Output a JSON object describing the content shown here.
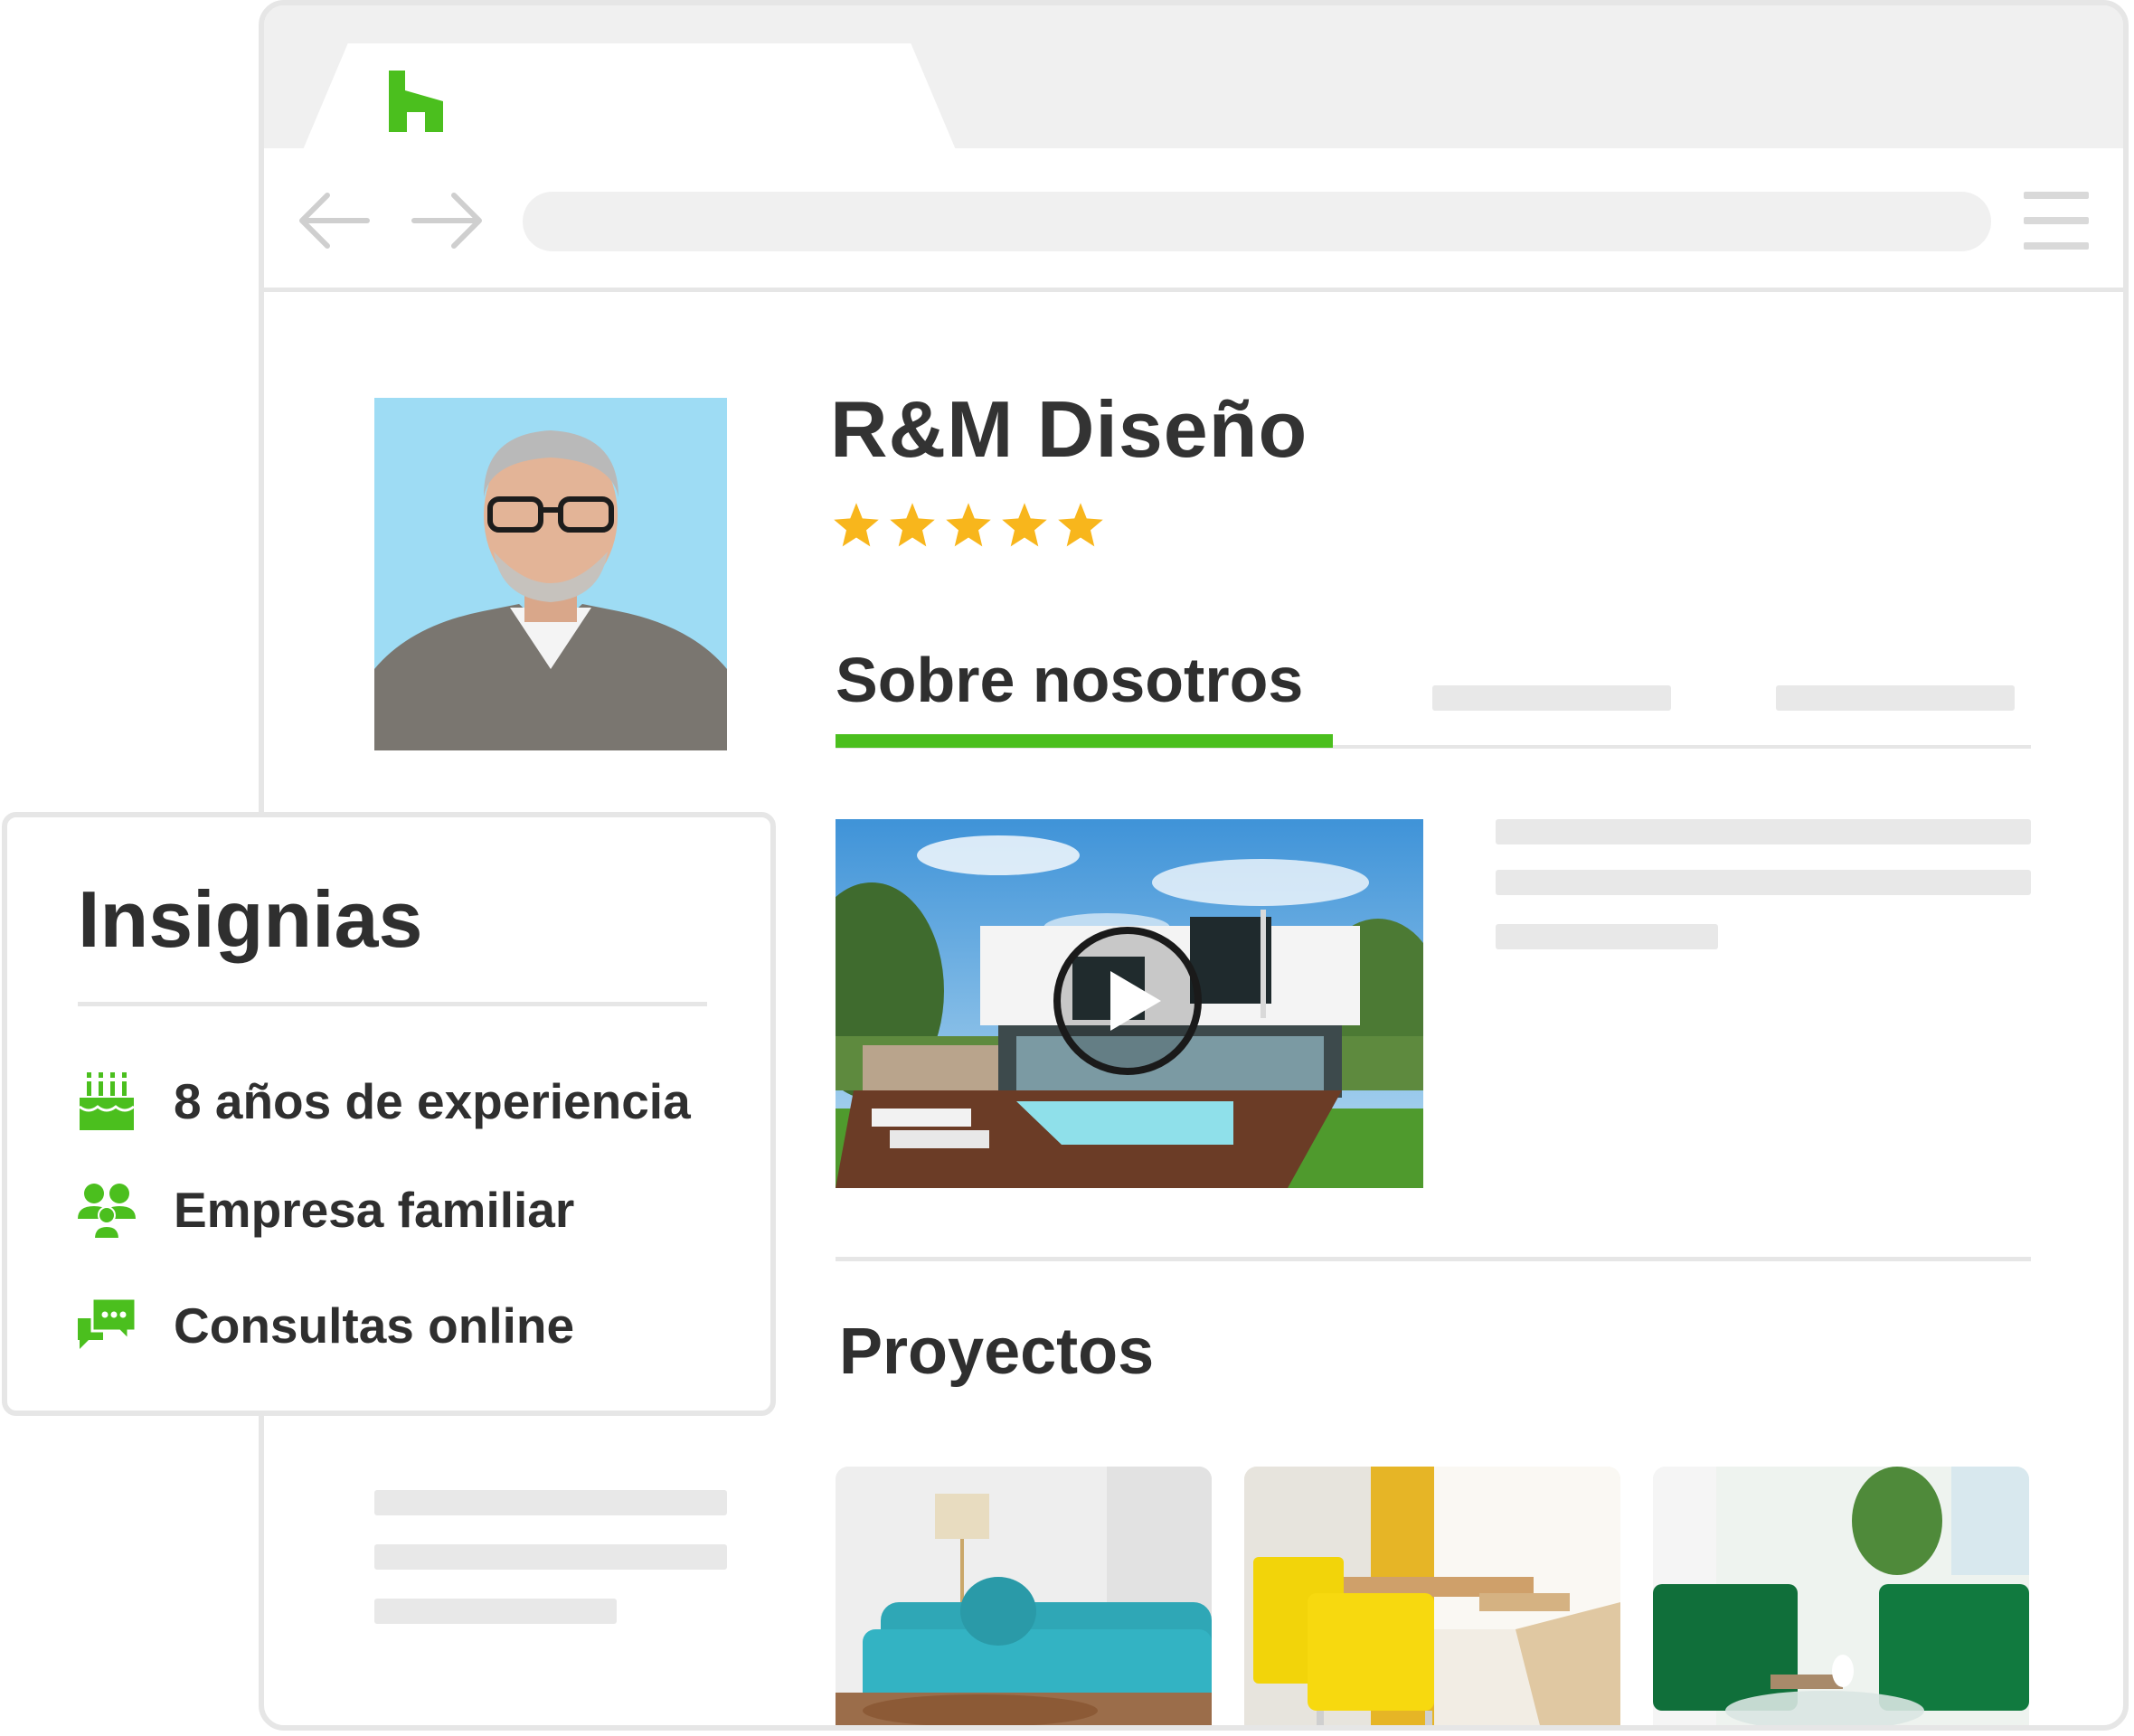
{
  "profile": {
    "company_name": "R&M Diseño",
    "rating_stars": 5
  },
  "tabs": [
    {
      "label": "Sobre nosotros",
      "active": true
    }
  ],
  "projects": {
    "title": "Proyectos"
  },
  "badges": {
    "title": "Insignias",
    "items": [
      {
        "icon": "cake-icon",
        "label": "8 años de experiencia"
      },
      {
        "icon": "family-icon",
        "label": "Empresa familiar"
      },
      {
        "icon": "chat-icon",
        "label": "Consultas online"
      }
    ]
  },
  "colors": {
    "accent": "#4bbf1e",
    "star": "#f8b61c",
    "placeholder": "#e8e8e8",
    "border": "#e6e6e6"
  }
}
